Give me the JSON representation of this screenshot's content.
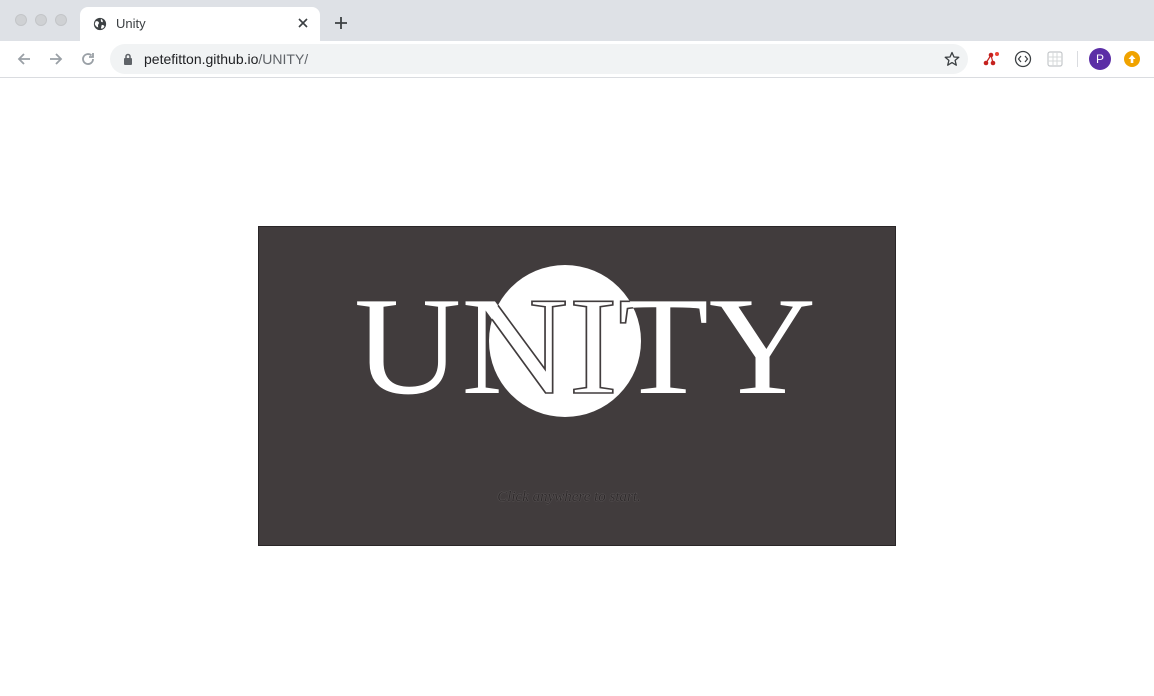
{
  "browser": {
    "tab": {
      "title": "Unity",
      "icon": "globe-icon"
    },
    "address": {
      "host": "petefitton.github.io",
      "path": "/UNITY/"
    },
    "profile": {
      "initial": "P",
      "color": "#5b2ea6"
    },
    "update_color": "#f0a300"
  },
  "game": {
    "title": "UNITY",
    "hint": "Click anywhere to start.",
    "background": "#413c3d"
  }
}
